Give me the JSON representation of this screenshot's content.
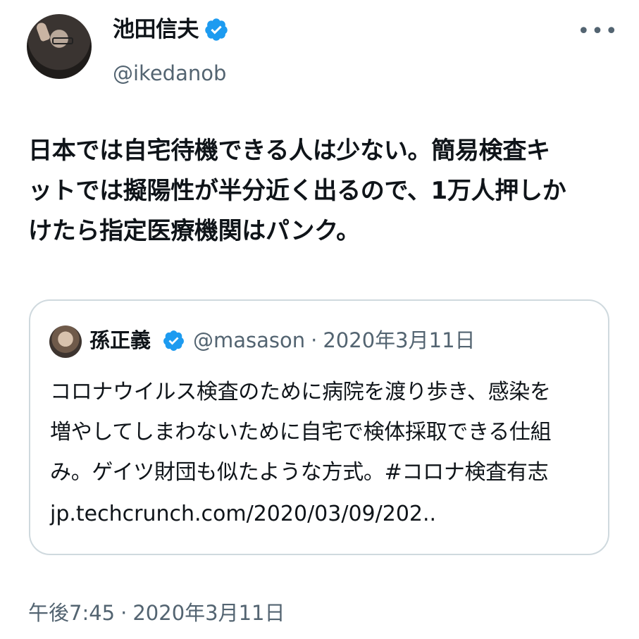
{
  "author": {
    "name": "池田信夫",
    "handle": "@ikedanob",
    "verified_icon": "verified-badge-icon"
  },
  "more_icon": "more-horizontal-icon",
  "tweet_text_lines": [
    "日本では自宅待機できる人は少ない。簡易検査キ",
    "ットでは擬陽性が半分近く出るので、1万人押しか",
    "けたら指定医療機関はパンク。"
  ],
  "quoted_tweet": {
    "name": "孫正義",
    "handle": "@masason",
    "separator": "·",
    "date": "2020年3月11日",
    "text_lines": [
      "コロナウイルス検査のために病院を渡り歩き、感染を",
      "増やしてしまわないために自宅で検体採取できる仕組",
      "み。ゲイツ財団も似たような方式。#コロナ検査有志"
    ],
    "link": "jp.techcrunch.com/2020/03/09/202.."
  },
  "timestamp": {
    "time": "午後7:45",
    "separator": "·",
    "date": "2020年3月11日"
  },
  "colors": {
    "verified": "#1d9bf0",
    "secondary_text": "#536471",
    "border": "#cfd9de"
  }
}
